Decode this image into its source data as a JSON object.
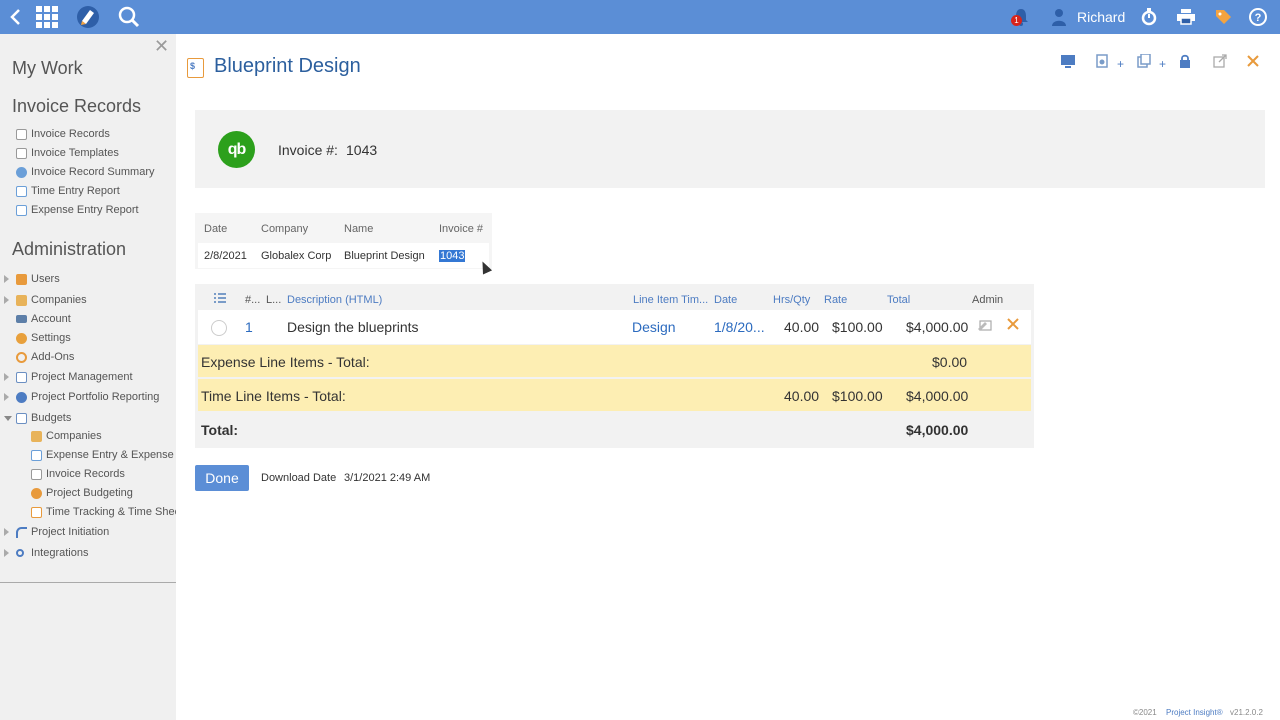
{
  "topbar": {
    "icons": [
      "back-icon",
      "apps-grid-icon",
      "project-logo-icon",
      "search-icon",
      "notification-bell-icon",
      "user-icon",
      "timer-icon",
      "print-icon",
      "tag-icon",
      "help-icon"
    ],
    "notification_count": "1",
    "user_name": "Richard",
    "help_label": "?"
  },
  "sidebar": {
    "my_work": "My Work",
    "invoice_records_heading": "Invoice Records",
    "invoice_items": [
      "Invoice Records",
      "Invoice Templates",
      "Invoice Record Summary",
      "Time Entry Report",
      "Expense Entry Report"
    ],
    "administration_heading": "Administration",
    "admin_items": [
      "Users",
      "Companies",
      "Account",
      "Settings",
      "Add-Ons",
      "Project Management",
      "Project Portfolio Reporting",
      "Budgets"
    ],
    "budget_items": [
      "Companies",
      "Expense Entry & Expense R",
      "Invoice Records",
      "Project Budgeting",
      "Time Tracking & Time Shee"
    ],
    "bottom_items": [
      "Project Initiation",
      "Integrations"
    ]
  },
  "page": {
    "title": "Blueprint Design",
    "invoice_label": "Invoice #:",
    "invoice_number": "1043",
    "qb_logo_text": "qb"
  },
  "summary": {
    "headers": [
      "Date",
      "Company",
      "Name",
      "Invoice #"
    ],
    "row": [
      "2/8/2021",
      "Globalex Corp",
      "Blueprint Design",
      "1043"
    ]
  },
  "items": {
    "headers": [
      "#...",
      "L...",
      "Description (HTML)",
      "Line Item Tim...",
      "Date",
      "Hrs/Qty",
      "Rate",
      "Total",
      "Admin"
    ],
    "row": {
      "num": "1",
      "description": "Design the blueprints",
      "line_item_type": "Design",
      "date": "1/8/20...",
      "hrs": "40.00",
      "rate": "$100.00",
      "total": "$4,000.00"
    },
    "expense_label": "Expense Line Items - Total:",
    "expense_total": "$0.00",
    "time_label": "Time Line Items - Total:",
    "time_hrs": "40.00",
    "time_rate": "$100.00",
    "time_total": "$4,000.00",
    "total_label": "Total:",
    "grand_total": "$4,000.00"
  },
  "footer_actions": {
    "done_label": "Done",
    "download_label": "Download Date",
    "download_value": "3/1/2021 2:49 AM"
  },
  "footer": {
    "copyright": "©2021",
    "brand": "Project Insight®",
    "version": "v21.2.0.2"
  },
  "colors": {
    "topbar": "#5b8ed6",
    "title": "#2c5f9e",
    "quickbooks": "#2ca01c",
    "highlight": "#fdeeb3"
  }
}
